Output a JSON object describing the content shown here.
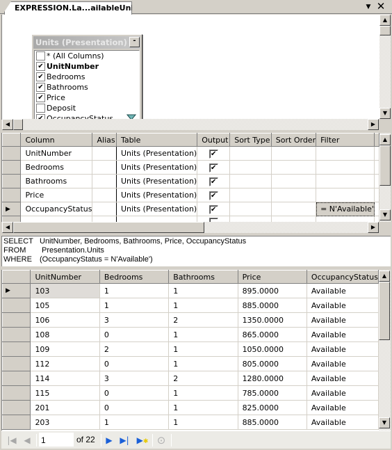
{
  "document_tab": {
    "title": "EXPRESSION.La...ailableUnits*",
    "dropdown_icon": "chevron-down-icon",
    "close_icon": "close-icon"
  },
  "diagram": {
    "table_title": "Units (Presentation)",
    "minimize_label": "-",
    "columns": [
      {
        "label": "* (All Columns)",
        "checked": false,
        "bold": false
      },
      {
        "label": "UnitNumber",
        "checked": true,
        "bold": true
      },
      {
        "label": "Bedrooms",
        "checked": true,
        "bold": false
      },
      {
        "label": "Bathrooms",
        "checked": true,
        "bold": false
      },
      {
        "label": "Price",
        "checked": true,
        "bold": false
      },
      {
        "label": "Deposit",
        "checked": false,
        "bold": false
      },
      {
        "label": "OccupancyStatus",
        "checked": true,
        "bold": false,
        "filtered": true
      }
    ],
    "check_glyph": "✔"
  },
  "criteria": {
    "headers": [
      "Column",
      "Alias",
      "Table",
      "Output",
      "Sort Type",
      "Sort Order",
      "Filter"
    ],
    "rows": [
      {
        "column": "UnitNumber",
        "alias": "",
        "table": "Units (Presentation)",
        "output": true,
        "sort_type": "",
        "sort_order": "",
        "filter": ""
      },
      {
        "column": "Bedrooms",
        "alias": "",
        "table": "Units (Presentation)",
        "output": true,
        "sort_type": "",
        "sort_order": "",
        "filter": ""
      },
      {
        "column": "Bathrooms",
        "alias": "",
        "table": "Units (Presentation)",
        "output": true,
        "sort_type": "",
        "sort_order": "",
        "filter": ""
      },
      {
        "column": "Price",
        "alias": "",
        "table": "Units (Presentation)",
        "output": true,
        "sort_type": "",
        "sort_order": "",
        "filter": ""
      },
      {
        "column": "OccupancyStatus",
        "alias": "",
        "table": "Units (Presentation)",
        "output": true,
        "sort_type": "",
        "sort_order": "",
        "filter": "= N'Available'",
        "current": true
      }
    ],
    "check_glyph": "✔",
    "current_row_glyph": "▶"
  },
  "sql": {
    "lines": [
      {
        "keyword": "SELECT",
        "text": "UnitNumber, Bedrooms, Bathrooms, Price, OccupancyStatus"
      },
      {
        "keyword": "FROM",
        "text": " Presentation.Units"
      },
      {
        "keyword": "WHERE",
        "text": "(OccupancyStatus = N'Available')"
      }
    ]
  },
  "results": {
    "headers": [
      "UnitNumber",
      "Bedrooms",
      "Bathrooms",
      "Price",
      "OccupancyStatus"
    ],
    "rows": [
      [
        "103",
        "1",
        "1",
        "895.0000",
        "Available"
      ],
      [
        "105",
        "1",
        "1",
        "885.0000",
        "Available"
      ],
      [
        "106",
        "3",
        "2",
        "1350.0000",
        "Available"
      ],
      [
        "108",
        "0",
        "1",
        "865.0000",
        "Available"
      ],
      [
        "109",
        "2",
        "1",
        "1050.0000",
        "Available"
      ],
      [
        "112",
        "0",
        "1",
        "805.0000",
        "Available"
      ],
      [
        "114",
        "3",
        "2",
        "1280.0000",
        "Available"
      ],
      [
        "115",
        "0",
        "1",
        "785.0000",
        "Available"
      ],
      [
        "201",
        "0",
        "1",
        "825.0000",
        "Available"
      ],
      [
        "203",
        "1",
        "1",
        "885.0000",
        "Available"
      ]
    ],
    "current_row_index": 0,
    "current_row_glyph": "▶"
  },
  "navigator": {
    "current_record": "1",
    "of_label": "of 22",
    "buttons": {
      "first": "⏮",
      "previous": "◀",
      "next": "▶",
      "last": "⏭",
      "new": "▶*",
      "stop": "⊙"
    }
  },
  "colors": {
    "chrome": "#d4d0c8",
    "accent_blue": "#1a5fd8",
    "new_star": "#e6c800",
    "filter_icon": "#1f6f6f"
  }
}
